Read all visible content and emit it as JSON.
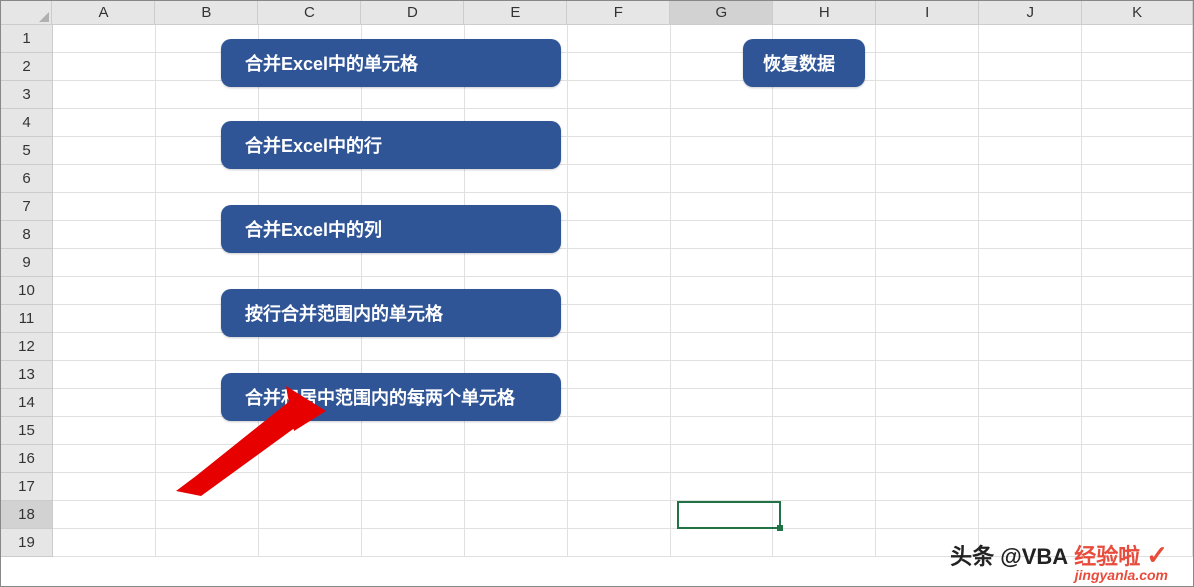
{
  "columns": [
    "A",
    "B",
    "C",
    "D",
    "E",
    "F",
    "G",
    "H",
    "I",
    "J",
    "K"
  ],
  "rows": [
    "1",
    "2",
    "3",
    "4",
    "5",
    "6",
    "7",
    "8",
    "9",
    "10",
    "11",
    "12",
    "13",
    "14",
    "15",
    "16",
    "17",
    "18",
    "19"
  ],
  "selected_column": "G",
  "selected_row": "18",
  "buttons": {
    "merge_cells": "合并Excel中的单元格",
    "merge_rows": "合并Excel中的行",
    "merge_cols": "合并Excel中的列",
    "merge_range_by_row": "按行合并范围内的单元格",
    "merge_center_pairs": "合并和居中范围内的每两个单元格",
    "restore_data": "恢复数据"
  },
  "watermark": {
    "prefix": "头条 @VBA",
    "brand": "经验啦",
    "domain": "jingyanla.com",
    "check": "✓"
  }
}
